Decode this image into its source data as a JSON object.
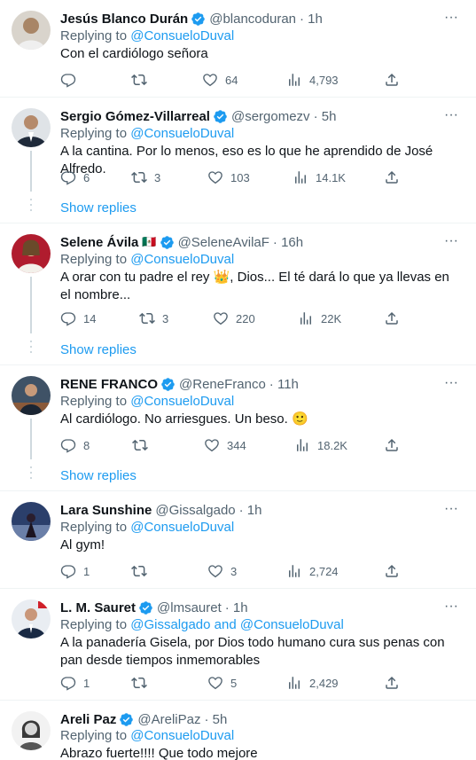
{
  "icons": {
    "reply": "reply-icon",
    "retweet": "retweet-icon",
    "like": "heart-icon",
    "views": "views-icon",
    "share": "share-icon",
    "more": "more-icon",
    "verified": "verified-badge-icon"
  },
  "colors": {
    "accent": "#1d9bf0",
    "muted": "#536471",
    "text": "#0f1419",
    "divider": "#eff3f4"
  },
  "replying_prefix": "Replying to",
  "show_replies_label": "Show replies",
  "more_label": "···",
  "tweets": [
    {
      "name": "Jesús Blanco Durán",
      "handle": "@blancoduran",
      "time": "· 1h",
      "reply_to": "@ConsueloDuval",
      "text": "Con el cardiólogo señora",
      "replies": "",
      "retweets": "",
      "likes": "64",
      "views": "4,793"
    },
    {
      "name": "Sergio Gómez-Villarreal",
      "handle": "@sergomezv",
      "time": "· 5h",
      "reply_to": "@ConsueloDuval",
      "text": "A la cantina. Por lo menos, eso es lo que he aprendido de José Alfredo.",
      "replies": "6",
      "retweets": "3",
      "likes": "103",
      "views": "14.1K"
    },
    {
      "name": "Selene Ávila",
      "flag": "🇲🇽",
      "handle": "@SeleneAvilaF",
      "time": "· 16h",
      "reply_to": "@ConsueloDuval",
      "text": "A orar con tu padre el rey 👑, Dios... El té dará lo que ya llevas en el nombre...",
      "replies": "14",
      "retweets": "3",
      "likes": "220",
      "views": "22K"
    },
    {
      "name": "RENE FRANCO",
      "handle": "@ReneFranco",
      "time": "· 11h",
      "reply_to": "@ConsueloDuval",
      "text": "Al cardiólogo. No arriesgues. Un beso. 🙂",
      "replies": "8",
      "retweets": "",
      "likes": "344",
      "views": "18.2K"
    },
    {
      "name": "Lara Sunshine",
      "handle": "@Gissalgado",
      "time": "· 1h",
      "reply_to": "@ConsueloDuval",
      "text": "Al gym!",
      "replies": "1",
      "retweets": "",
      "likes": "3",
      "views": "2,724"
    },
    {
      "name": "L. M. Sauret",
      "handle": "@lmsauret",
      "time": "· 1h",
      "reply_to": "@Gissalgado and @ConsueloDuval",
      "text": "A la panadería Gisela, por Dios todo humano cura sus penas con pan desde tiempos inmemorables",
      "replies": "1",
      "retweets": "",
      "likes": "5",
      "views": "2,429"
    },
    {
      "name": "Areli Paz",
      "handle": "@AreliPaz",
      "time": "· 5h",
      "reply_to": "@ConsueloDuval",
      "text": "Abrazo fuerte!!!! Que todo mejore"
    }
  ]
}
